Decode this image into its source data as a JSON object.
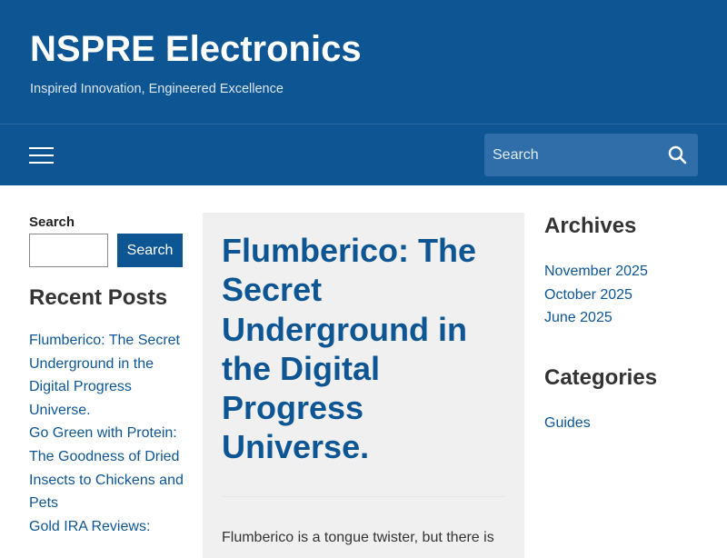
{
  "header": {
    "site_title": "NSPRE Electronics",
    "tagline": "Inspired Innovation, Engineered Excellence",
    "search_placeholder": "Search",
    "menu_icon": "hamburger-menu-icon",
    "search_icon": "search-icon"
  },
  "left_sidebar": {
    "search_label": "Search",
    "search_button": "Search",
    "recent_posts_title": "Recent Posts",
    "recent_posts": [
      "Flumberico: The Secret Underground in the Digital Progress Universe.",
      "Go Green with Protein: The Goodness of Dried Insects to Chickens and Pets",
      "Gold IRA Reviews:"
    ]
  },
  "main": {
    "post_title": "Flumberico: The Secret Underground in the Digital Progress Universe.",
    "excerpt": "Flumberico is a tongue twister, but there is"
  },
  "right_sidebar": {
    "archives_title": "Archives",
    "archives": [
      "November 2025",
      "October 2025",
      "June 2025"
    ],
    "categories_title": "Categories",
    "categories": [
      "Guides"
    ]
  },
  "colors": {
    "brand_blue": "#0d5593",
    "search_field": "#2f6ea8",
    "card_background": "#f0f0f0"
  }
}
